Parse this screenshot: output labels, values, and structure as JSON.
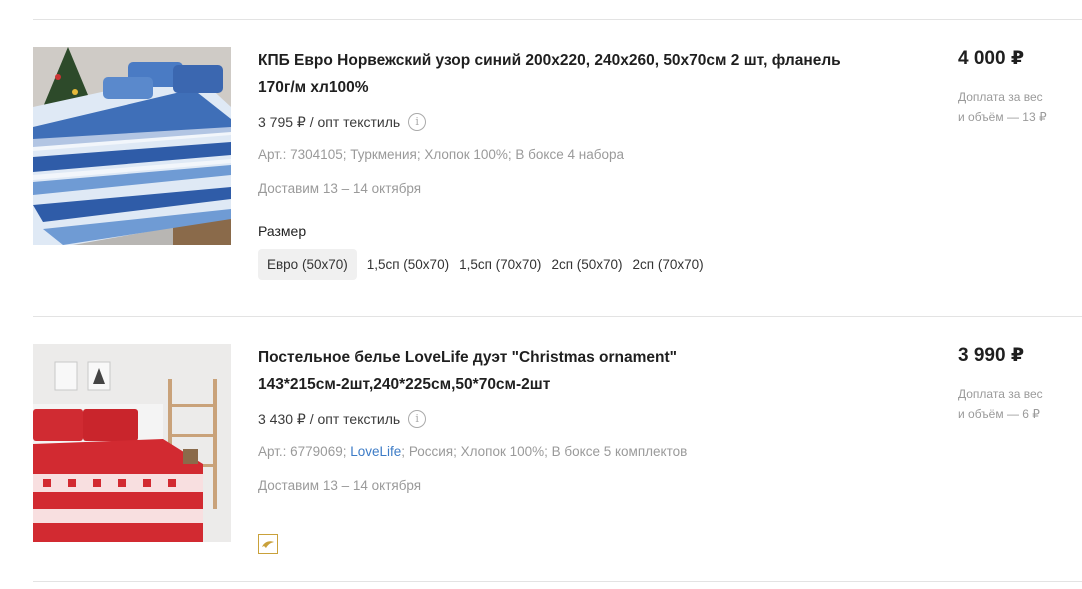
{
  "products": [
    {
      "title_line1": "КПБ Евро Норвежский узор синий 200х220, 240х260, 50х70см 2 шт, фланель",
      "title_line2": "170г/м хл100%",
      "opt_price": "3 795 ₽ / опт текстиль",
      "props": {
        "article": "Арт.: 7304105;",
        "country": "Туркмения;",
        "material": "Хлопок 100%;",
        "box": "В боксе 4 набора"
      },
      "delivery": "Доставим 13 – 14 октября",
      "size_label": "Размер",
      "sizes": [
        "Евро (50х70)",
        "1,5сп (50х70)",
        "1,5сп (70х70)",
        "2сп (50х70)",
        "2сп (70х70)"
      ],
      "selected_size": "Евро (50х70)",
      "price": "4 000 ₽",
      "surcharge_line1": "Доплата за вес",
      "surcharge_line2": "и объём — 13 ₽",
      "image_icon": "blue-norwegian-bedding-photo"
    },
    {
      "title_line1": "Постельное белье LoveLife дуэт \"Christmas ornament\"",
      "title_line2": "143*215см-2шт,240*225см,50*70см-2шт",
      "opt_price": "3 430 ₽ / опт текстиль",
      "props": {
        "article": "Арт.: 6779069;",
        "brand": "LoveLife",
        "brand_sep": ";",
        "country": "Россия;",
        "material": "Хлопок 100%;",
        "box": "В боксе 5 комплектов"
      },
      "delivery": "Доставим 13 – 14 октября",
      "price": "3 990 ₽",
      "surcharge_line1": "Доплата за вес",
      "surcharge_line2": "и объём — 6 ₽",
      "image_icon": "red-christmas-bedding-photo",
      "badge_icon": "dolphin-badge-icon"
    }
  ],
  "colors": {
    "link": "#3c7bc6",
    "muted": "#9a9a9a",
    "badge": "#c9a13a"
  }
}
